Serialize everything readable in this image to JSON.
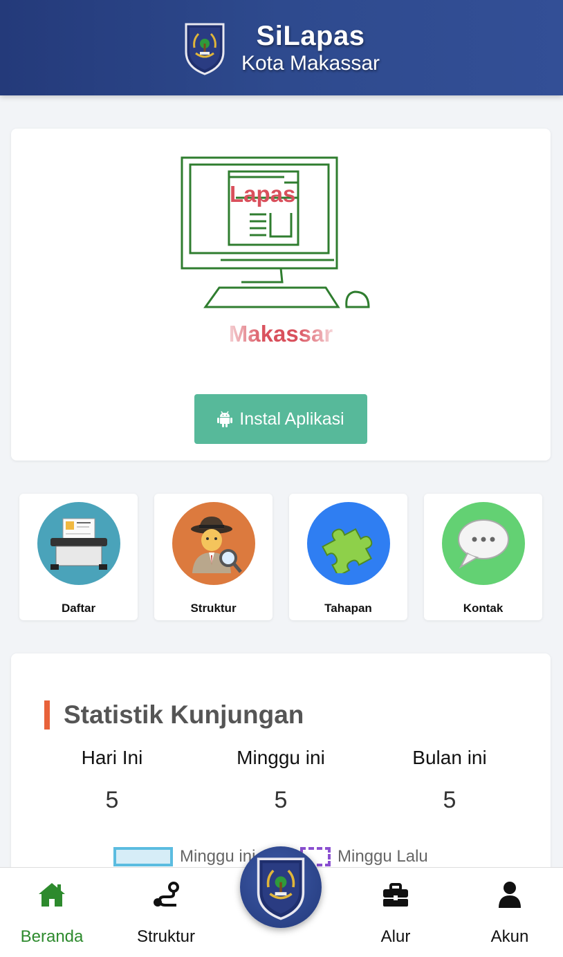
{
  "header": {
    "title": "SiLapas",
    "subtitle": "Kota Makassar",
    "emblem_icon": "kemenkumham-emblem-icon"
  },
  "hero": {
    "illustration_text": "Lapas",
    "city_text": "Makassar",
    "install_button": "Instal Aplikasi",
    "install_icon": "android-icon"
  },
  "menu": [
    {
      "label": "Daftar",
      "icon": "printer-icon",
      "color": "#4aa3ba"
    },
    {
      "label": "Struktur",
      "icon": "detective-icon",
      "color": "#dc7a3e"
    },
    {
      "label": "Tahapan",
      "icon": "puzzle-icon",
      "color": "#2f7ef2"
    },
    {
      "label": "Kontak",
      "icon": "chat-bubble-icon",
      "color": "#63d173"
    }
  ],
  "stats": {
    "title": "Statistik Kunjungan",
    "items": [
      {
        "label": "Hari Ini",
        "value": "5"
      },
      {
        "label": "Minggu ini",
        "value": "5"
      },
      {
        "label": "Bulan ini",
        "value": "5"
      }
    ],
    "legend": [
      {
        "label": "Minggu ini",
        "color": "#5bbce0"
      },
      {
        "label": "Minggu Lalu",
        "color": "#8a4fd0"
      }
    ]
  },
  "nav": {
    "items": [
      {
        "label": "Beranda",
        "icon": "home-icon",
        "active": true
      },
      {
        "label": "Struktur",
        "icon": "route-icon",
        "active": false
      },
      {
        "label": "Alur",
        "icon": "briefcase-icon",
        "active": false
      },
      {
        "label": "Akun",
        "icon": "user-icon",
        "active": false
      }
    ],
    "center_icon": "kemenkumham-emblem-icon"
  },
  "colors": {
    "header": "#2e4a8e",
    "accent_green": "#57b99a",
    "active_nav": "#2d8a2d",
    "title_bar": "#e8623a",
    "lapas_red": "#d9505c"
  }
}
